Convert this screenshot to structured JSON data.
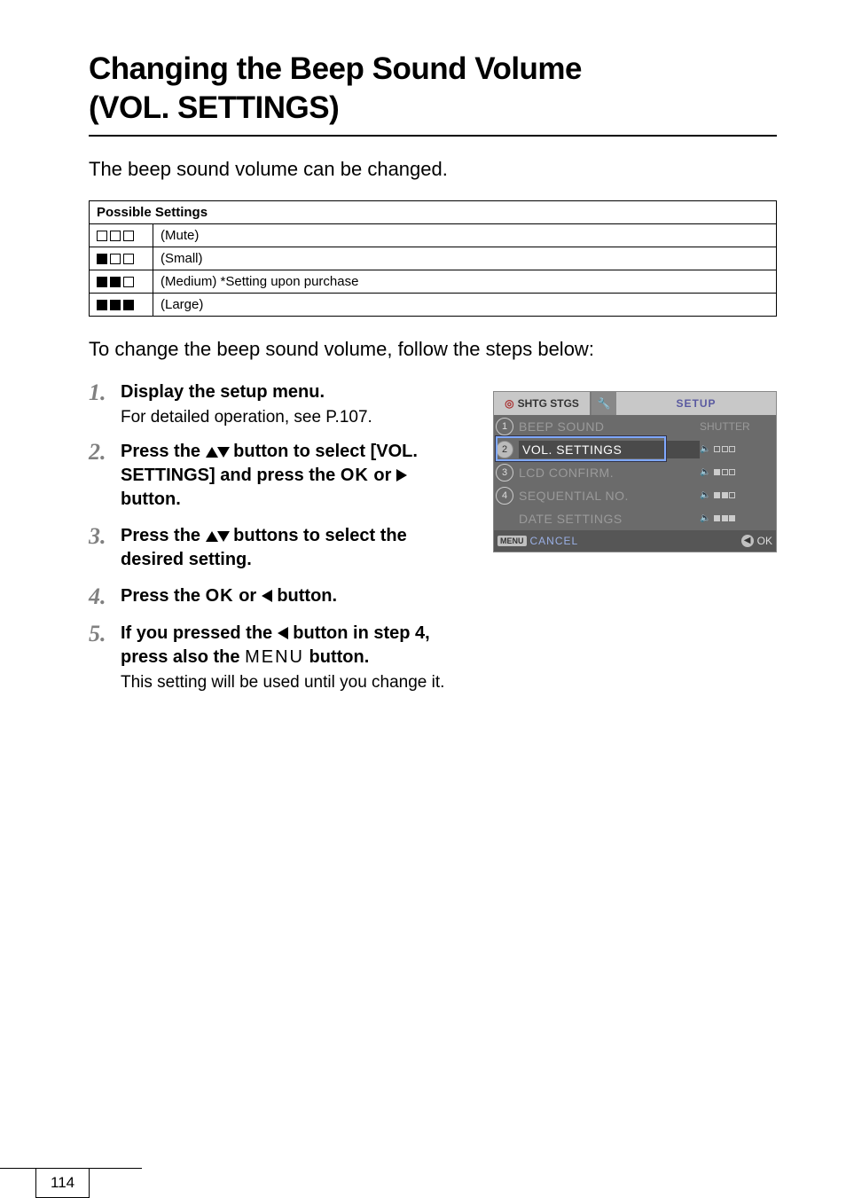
{
  "title_line1": "Changing the Beep Sound Volume",
  "title_line2": "(VOL. SETTINGS)",
  "intro": "The beep sound volume can be changed.",
  "table_header": "Possible Settings",
  "settings": [
    {
      "filled": 0,
      "label": "(Mute)"
    },
    {
      "filled": 1,
      "label": "(Small)"
    },
    {
      "filled": 2,
      "label": "(Medium)  *Setting upon purchase"
    },
    {
      "filled": 3,
      "label": "(Large)"
    }
  ],
  "lead": "To change the beep sound volume, follow the steps below:",
  "steps": [
    {
      "num": "1.",
      "head": "Display the setup menu.",
      "sub": "For detailed operation, see P.107."
    },
    {
      "num": "2.",
      "head_pre": "Press the ",
      "head_post": " button to select [VOL. SETTINGS] and press the ",
      "ok": "O",
      "ok2": "K",
      "or": " or ",
      "button_word": " button."
    },
    {
      "num": "3.",
      "head_pre": "Press the ",
      "head_post": " buttons to select the desired setting."
    },
    {
      "num": "4.",
      "head_pre": "Press the ",
      "ok": "O",
      "ok2": "K",
      "or": " or ",
      "button_word": " button."
    },
    {
      "num": "5.",
      "head_pre": "If you pressed the ",
      "head_mid": " button in step 4, press also the ",
      "menu": "MENU",
      "button_word": " button.",
      "sub": "This setting will be used until you change it."
    }
  ],
  "lcd": {
    "tab_cam_icon": "◎",
    "tab_cam": "SHTG STGS",
    "tab_wrench": "🔧",
    "tab_setup": "SETUP",
    "rows": [
      {
        "label": "BEEP SOUND",
        "val_text": "SHUTTER",
        "dim": true
      },
      {
        "label": "VOL. SETTINGS",
        "bars": 0,
        "selected": true
      },
      {
        "label": "LCD CONFIRM.",
        "bars": 1,
        "dim": true
      },
      {
        "label": "SEQUENTIAL NO.",
        "bars": 2,
        "dim": true
      },
      {
        "label": "DATE SETTINGS",
        "bars": 3,
        "dim": true,
        "noidx": true
      }
    ],
    "footer_menu": "MENU",
    "footer_cancel": "CANCEL",
    "footer_ok": "OK"
  },
  "page_number": "114"
}
